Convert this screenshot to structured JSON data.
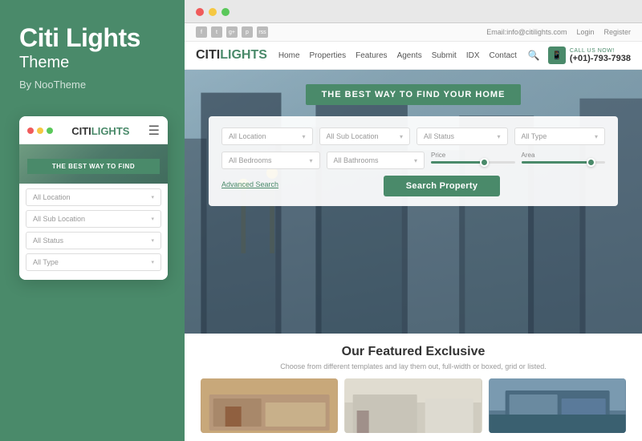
{
  "left": {
    "brand_title": "Citi Lights",
    "brand_subtitle": "Theme",
    "brand_by": "By NooTheme"
  },
  "mobile": {
    "logo_citi": "CITI",
    "logo_lights": "LIGHTS",
    "hero_text": "THE BEST WAY TO FIND",
    "fields": [
      {
        "label": "All Location",
        "id": "mob-loc"
      },
      {
        "label": "All Sub Location",
        "id": "mob-subloc"
      },
      {
        "label": "All Status",
        "id": "mob-status"
      },
      {
        "label": "All Type",
        "id": "mob-type"
      }
    ]
  },
  "website": {
    "topbar": {
      "email": "Email:info@citilights.com",
      "login": "Login",
      "register": "Register"
    },
    "nav": {
      "logo_citi": "CITI",
      "logo_lights": "LIGHTS",
      "links": [
        "Home",
        "Properties",
        "Features",
        "Agents",
        "Submit",
        "IDX",
        "Contact"
      ],
      "phone_label": "CALL US NOW!",
      "phone_number": "(+01)-793-7938"
    },
    "hero": {
      "banner": "THE BEST WAY TO FIND YOUR HOME",
      "selects": [
        {
          "label": "All Location",
          "id": "loc"
        },
        {
          "label": "All Sub Location",
          "id": "subloc"
        },
        {
          "label": "All Status",
          "id": "status"
        },
        {
          "label": "All Type",
          "id": "type"
        }
      ],
      "left_selects": [
        {
          "label": "All Bedrooms",
          "id": "beds"
        },
        {
          "label": "All Bathrooms",
          "id": "baths"
        }
      ],
      "price_label": "Price",
      "area_label": "Area",
      "advanced_search": "Advanced Search",
      "search_btn": "Search Property"
    },
    "featured": {
      "title": "Our Featured Exclusive",
      "subtitle": "Choose from different templates and lay them out, full-width or boxed, grid or listed."
    }
  }
}
